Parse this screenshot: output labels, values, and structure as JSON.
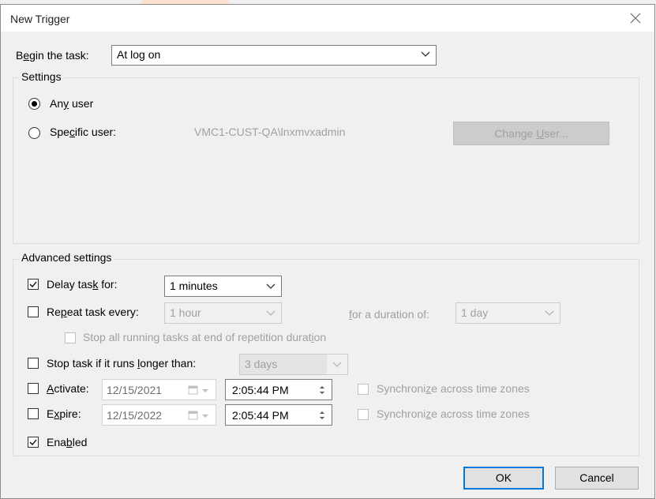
{
  "dialog": {
    "title": "New Trigger",
    "begin_label_pre": "B",
    "begin_label_u": "e",
    "begin_label_post": "gin the task:",
    "begin_value": "At log on",
    "settings_legend": "Settings",
    "any_user_pre": "An",
    "any_user_u": "y",
    "any_user_post": " user",
    "specific_user_pre": "Spe",
    "specific_user_u": "c",
    "specific_user_post": "ific user:",
    "specific_user_value": "VMC1-CUST-QA\\lnxmvxadmin",
    "change_user_pre": "Change ",
    "change_user_u": "U",
    "change_user_post": "ser...",
    "advanced_legend": "Advanced settings",
    "delay_pre": "Delay tas",
    "delay_u": "k",
    "delay_post": " for:",
    "delay_value": "1 minutes",
    "repeat_pre": "Re",
    "repeat_u": "p",
    "repeat_post": "eat task every:",
    "repeat_value": "1 hour",
    "duration_pre": "",
    "duration_u": "f",
    "duration_post": "or a duration of:",
    "duration_value": "1 day",
    "stop_all_pre": "Stop all running tasks at end of repetition durat",
    "stop_all_u": "i",
    "stop_all_post": "on",
    "stop_if_pre": "Stop task if it runs ",
    "stop_if_u": "l",
    "stop_if_post": "onger than:",
    "stop_if_value": "3 days",
    "activate_pre": "",
    "activate_u": "A",
    "activate_post": "ctivate:",
    "activate_date": "12/15/2021",
    "activate_time": "2:05:44 PM",
    "expire_pre": "E",
    "expire_u": "x",
    "expire_post": "pire:",
    "expire_date": "12/15/2022",
    "expire_time": "2:05:44 PM",
    "sync_pre": "Synchroni",
    "sync_u": "z",
    "sync_post": "e across time zones",
    "enabled_pre": "Ena",
    "enabled_u": "b",
    "enabled_post": "led",
    "ok_label": "OK",
    "cancel_label": "Cancel"
  },
  "state": {
    "any_user_selected": true,
    "delay_checked": true,
    "repeat_checked": false,
    "stop_if_checked": false,
    "activate_checked": false,
    "expire_checked": false,
    "enabled_checked": true
  },
  "colors": {
    "accent": "#0078d7",
    "disabled_text": "#a0a0a0",
    "dialog_bg": "#f0f0f0"
  }
}
